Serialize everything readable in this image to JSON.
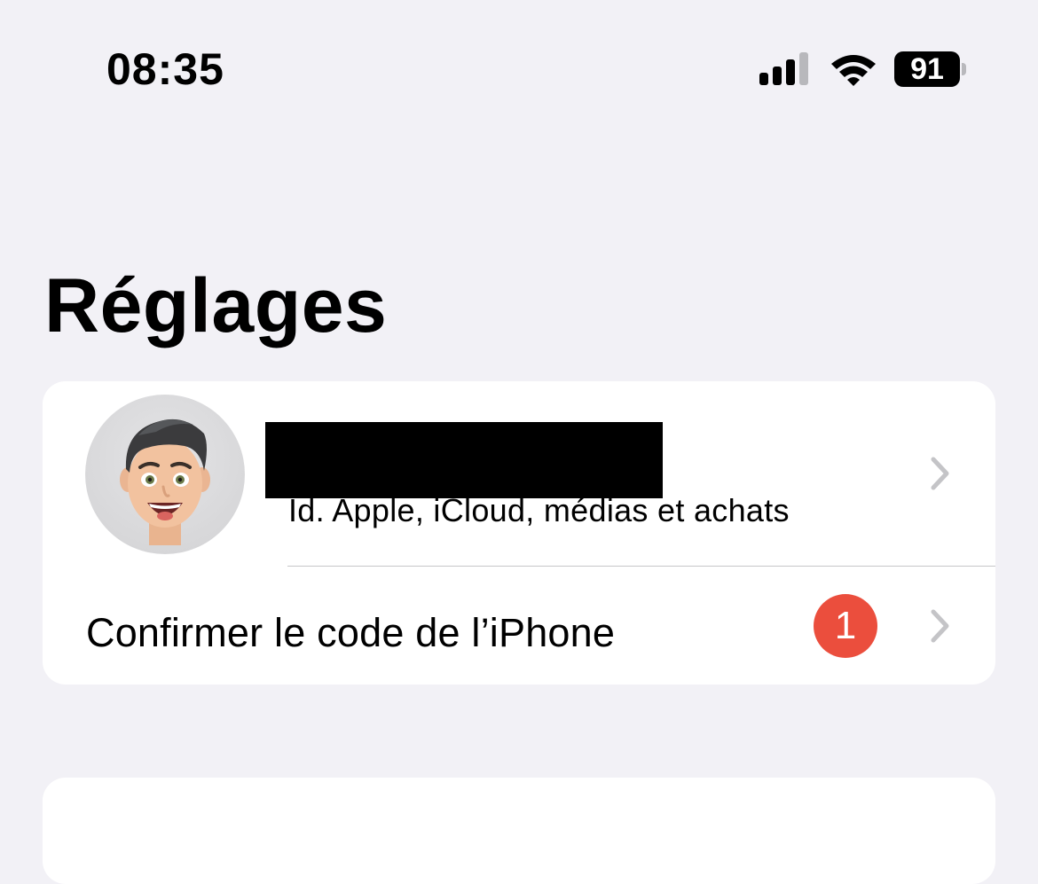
{
  "status_bar": {
    "time": "08:35",
    "battery_level": "91",
    "signal_icon": "cellular-signal-icon",
    "wifi_icon": "wifi-icon"
  },
  "page": {
    "title": "Réglages"
  },
  "account_card": {
    "profile": {
      "avatar_icon": "memoji-avatar-icon",
      "subtitle": "Id. Apple, iCloud, médias et achats",
      "chevron_icon": "chevron-right-icon"
    },
    "passcode_row": {
      "label": "Confirmer le code de l’iPhone",
      "badge_count": "1",
      "chevron_icon": "chevron-right-icon"
    }
  },
  "colors": {
    "background": "#f2f1f6",
    "card": "#ffffff",
    "badge": "#eb4e3d",
    "chevron": "#c4c4c7",
    "divider": "#c6c6c8"
  }
}
